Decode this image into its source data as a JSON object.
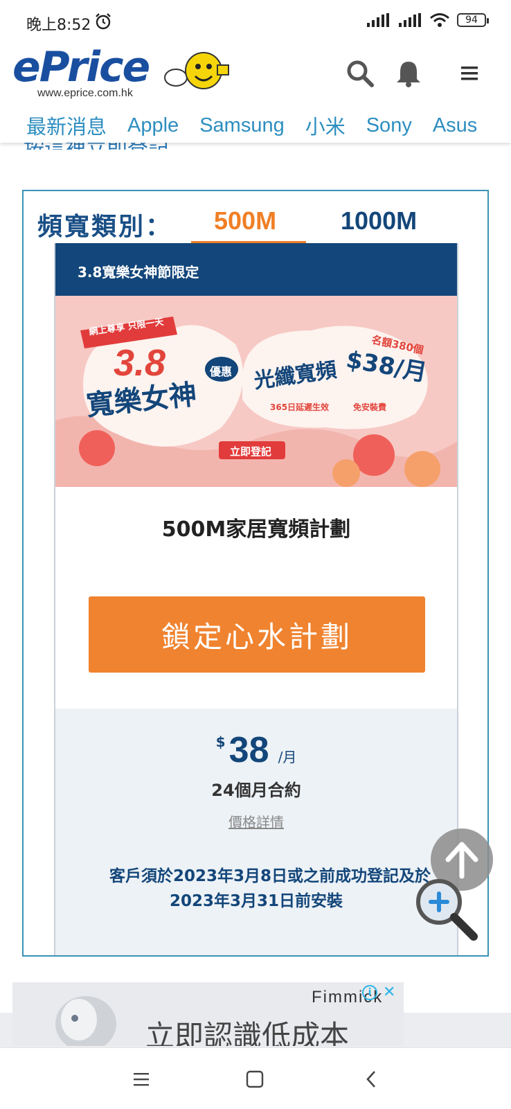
{
  "status_bar": {
    "time": "晚上8:52",
    "battery": "94"
  },
  "header": {
    "logo_text": "ePrice",
    "logo_url": "www.eprice.com.hk"
  },
  "nav": {
    "items": [
      "最新消息",
      "Apple",
      "Samsung",
      "小米",
      "Sony",
      "Asus"
    ]
  },
  "partial_text": "按這裡立即登記",
  "widget": {
    "bandwidth_label": "頻寬類別：",
    "tabs": [
      "500M",
      "1000M"
    ],
    "selected_tab": "500M",
    "card_header": "3.8寬樂女神節限定",
    "banner": {
      "tag": "網上尊享 只限一天",
      "event_big": "3.8",
      "event_title": "寬樂女神",
      "badge": "優惠",
      "product": "光纖寬頻",
      "price": "$38/月",
      "quota": "名額380個",
      "benefit1": "365日延遲生效",
      "benefit2": "免安裝費",
      "register": "立即登記"
    },
    "plan_title": "500M家居寬頻計劃",
    "cta_label": "鎖定心水計劃",
    "price_currency": "$",
    "price_value": "38",
    "price_unit": "/月",
    "contract": "24個月合約",
    "details_link": "價格詳情",
    "notice_line1": "客戶須於2023年3月8日或之前成功登記及於",
    "notice_line2": "2023年3月31日前安裝"
  },
  "ad": {
    "brand": "Fimmick",
    "text": "立即認識低成本"
  },
  "colors": {
    "brand_blue": "#13467a",
    "accent_orange": "#f0832f",
    "link_blue": "#2d8ec0"
  }
}
